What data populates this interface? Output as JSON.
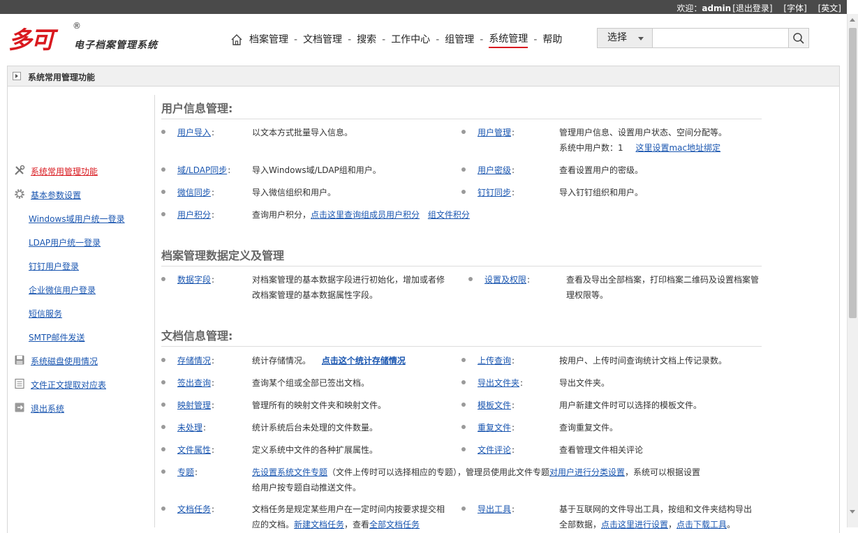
{
  "topbar": {
    "welcome": "欢迎：",
    "user": "admin",
    "logout": "[退出登录]",
    "font": "[字体]",
    "english": "[英文]"
  },
  "logo": {
    "mark": "多可",
    "registered": "®",
    "subtitle": "电子档案管理系统"
  },
  "nav": {
    "items": [
      "档案管理",
      "文档管理",
      "搜索",
      "工作中心",
      "组管理",
      "系统管理",
      "帮助"
    ],
    "separator": "-",
    "active_index": 5
  },
  "search": {
    "scope_label": "选择",
    "input_value": "",
    "placeholder": ""
  },
  "section_bar": {
    "title": "系统常用管理功能"
  },
  "sidebar": {
    "items": [
      {
        "label": "系统常用管理功能",
        "icon": "tools-icon"
      },
      {
        "label": "基本参数设置",
        "icon": "gear-icon"
      },
      {
        "label": "Windows域用户统一登录"
      },
      {
        "label": "LDAP用户统一登录"
      },
      {
        "label": "钉钉用户登录"
      },
      {
        "label": "企业微信用户登录"
      },
      {
        "label": "短信服务"
      },
      {
        "label": "SMTP邮件发送"
      },
      {
        "label": "系统磁盘使用情况",
        "icon": "disk-icon"
      },
      {
        "label": "文件正文提取对应表",
        "icon": "document-icon"
      },
      {
        "label": "退出系统",
        "icon": "exit-icon"
      }
    ]
  },
  "sections": {
    "user": {
      "title": "用户信息管理:",
      "import_label": "用户导入",
      "import_desc": "以文本方式批量导入信息。",
      "manage_label": "用户管理",
      "manage_desc": "管理用户信息、设置用户状态、空间分配等。",
      "user_count_text": "系统中用户数：",
      "user_count": "1",
      "mac_link": "这里设置mac地址绑定",
      "ldap_label": "域/LDAP同步",
      "ldap_desc": "导入Windows域/LDAP组和用户。",
      "secret_label": "用户密级",
      "secret_desc": "查看设置用户的密级。",
      "wechat_label": "微信同步",
      "wechat_desc": "导入微信组织和用户。",
      "dingtalk_label": "钉钉同步",
      "dingtalk_desc": "导入钉钉组织和用户。",
      "points_label": "用户积分",
      "points_desc": "查询用户积分，",
      "points_link1": "点击这里查询组成员用户积分",
      "points_link2": "组文件积分"
    },
    "archive": {
      "title": "档案管理数据定义及管理",
      "field_label": "数据字段",
      "field_desc1": "对档案管理的基本数据字段进行初始化，增加或者修",
      "field_desc2": "改档案管理的基本数据属性字段。",
      "perm_label": "设置及权限",
      "perm_desc1": "查看及导出全部档案，打印档案二维码及设置档案管",
      "perm_desc2": "理权限等。"
    },
    "doc": {
      "title": "文档信息管理:",
      "storage_label": "存储情况",
      "storage_desc": "统计存储情况。",
      "storage_link": "点击这个统计存储情况",
      "upload_label": "上传查询",
      "upload_desc": "按用户、上传时间查询统计文档上传记录数。",
      "checkout_label": "签出查询",
      "checkout_desc": "查询某个组或全部已签出文档。",
      "export_folder_label": "导出文件夹",
      "export_folder_desc": "导出文件夹。",
      "mapping_label": "映射管理",
      "mapping_desc": "管理所有的映射文件夹和映射文件。",
      "template_label": "模板文件",
      "template_desc": "用户新建文件时可以选择的模板文件。",
      "unprocessed_label": "未处理",
      "unprocessed_desc": "统计系统后台未处理的文件数量。",
      "duplicate_label": "重复文件",
      "duplicate_desc": "查询重复文件。",
      "attr_label": "文件属性",
      "attr_desc": "定义系统中文件的各种扩展属性。",
      "comment_label": "文件评论",
      "comment_desc": "查看管理文件相关评论",
      "topic_label": "专题",
      "topic_link1": "先设置系统文件专题",
      "topic_desc1": "（文件上传时可以选择相应的专题），管理员使用此文件专题",
      "topic_link2": "对用户进行分类设置",
      "topic_desc2": "，系统可以根据设置",
      "topic_desc3": "给用户按专题自动推送文件。",
      "task_label": "文档任务",
      "task_desc1": "文档任务是规定某些用户在一定时间内按要求提交相",
      "task_desc2": "应的文档。",
      "task_link1": "新建文档任务",
      "task_desc3": "，查看",
      "task_link2": "全部文档任务",
      "exporttool_label": "导出工具",
      "exporttool_desc1": "基于互联网的文件导出工具，按组和文件夹结构导出",
      "exporttool_desc2": "全部数据，",
      "exporttool_link1": "点击这里进行设置",
      "exporttool_desc3": "，",
      "exporttool_link2": "点击下载工具",
      "exporttool_desc4": "。"
    },
    "colon": ":"
  },
  "colors": {
    "accent": "#d9191f",
    "link": "#1a56b0",
    "topbar": "#4a4a4a"
  }
}
